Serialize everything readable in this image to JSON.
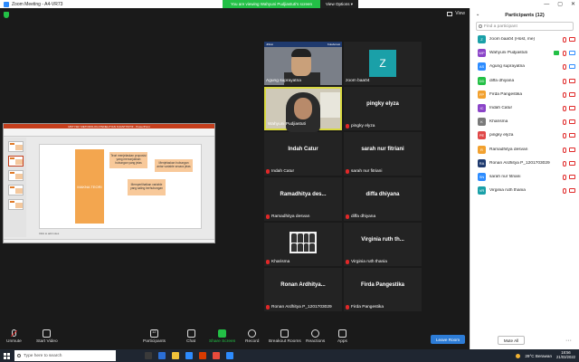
{
  "window": {
    "title": "Zoom Meeting - A4-VR73",
    "share_banner": "You are viewing Wahyuni Pudjiastuti's screen",
    "view_options": "View Options ▾",
    "controls": [
      "—",
      "▢",
      "✕"
    ]
  },
  "main": {
    "view_label": "View"
  },
  "shared_screen": {
    "window_title": "MKTI SR: METODOLOGI PENELITIAN KUANTITATIF - PowerPoint",
    "slide": {
      "main_box": "MAKNA TEORI",
      "boxes": [
        "Teori menjelaskan proposisi yang menunjukkan hubungan yang jelas",
        "Menjelaskan hubungan antar variable secara jelas",
        "Memperlihatkan variable yang saling berhubungan"
      ]
    },
    "notes": "Click to add notes"
  },
  "tiles": [
    {
      "name": "Agung suprayatna",
      "muted": false,
      "kind": "video-man"
    },
    {
      "name": "zoom baa04",
      "muted": false,
      "kind": "avatar",
      "avatar_letter": "Z"
    },
    {
      "name": "Wahyuni Pudjiastuti",
      "muted": false,
      "kind": "video-woman"
    },
    {
      "name": "pingky elyza",
      "display": "pingky elyza",
      "muted": true
    },
    {
      "name": "Indah Catur",
      "display": "Indah Catur",
      "muted": true
    },
    {
      "name": "sarah nur fitriani",
      "display": "sarah nur fitriani",
      "muted": true
    },
    {
      "name": "Ramadhitya desvan",
      "display": "Ramadhitya des...",
      "muted": true
    },
    {
      "name": "diffa dhiyana",
      "display": "diffa dhiyana",
      "muted": true
    },
    {
      "name": "Kharisma",
      "muted": true,
      "kind": "image"
    },
    {
      "name": "Virginia ruth thania",
      "display": "Virginia ruth th...",
      "muted": true
    },
    {
      "name": "Ronan Ardhitya P_1201703029",
      "display": "Ronan Ardhitya...",
      "muted": true
    },
    {
      "name": "Firda Pangestika",
      "display": "Firda Pangestika",
      "muted": true
    }
  ],
  "toolbar": {
    "unmute": "Unmute",
    "start_video": "Start Video",
    "participants": "Participants",
    "participants_count": "12",
    "chat": "Chat",
    "share_screen": "Share Screen",
    "record": "Record",
    "breakout": "Breakout Rooms",
    "reactions": "Reactions",
    "apps": "Apps",
    "leave": "Leave Room"
  },
  "participants_panel": {
    "title": "Participants (12)",
    "search_placeholder": "Find a participant",
    "items": [
      {
        "initials": "Z",
        "name": "zoom baa04 (Host, me)",
        "color": "#1aa0a8"
      },
      {
        "initials": "WP",
        "name": "Wahyuni Pudjiastuti",
        "color": "#8b44c8",
        "video_on": true
      },
      {
        "initials": "AS",
        "name": "Agung suprayatna",
        "color": "#2d8cff",
        "video_on": true
      },
      {
        "initials": "DD",
        "name": "diffa dhiyana",
        "color": "#23c046"
      },
      {
        "initials": "FP",
        "name": "Firda Pangestika",
        "color": "#f2a12f"
      },
      {
        "initials": "IC",
        "name": "Indah Catur",
        "color": "#8b44c8"
      },
      {
        "initials": "K",
        "name": "Kharisma",
        "color": "#7a7a7a"
      },
      {
        "initials": "PE",
        "name": "pingky elyza",
        "color": "#e04848"
      },
      {
        "initials": "R",
        "name": "Ramadhitya desvan",
        "color": "#f2a12f"
      },
      {
        "initials": "RA",
        "name": "Ronan Ardhitya P_1201703029",
        "color": "#1f3a6e"
      },
      {
        "initials": "SN",
        "name": "sarah nur fitriani",
        "color": "#2d8cff"
      },
      {
        "initials": "VR",
        "name": "Virginia ruth thania",
        "color": "#1aa0a8"
      }
    ],
    "mute_all": "Mute All",
    "more": "···"
  },
  "taskbar": {
    "search_placeholder": "Type here to search",
    "weather": "29°C Berawan",
    "time": "18:56",
    "date": "21/03/2022",
    "app_colors": [
      "#3a3a3a",
      "#2b6fd6",
      "#f0c23a",
      "#2d8cff",
      "#d83b01",
      "#e94b3c",
      "#2d8cff"
    ]
  }
}
